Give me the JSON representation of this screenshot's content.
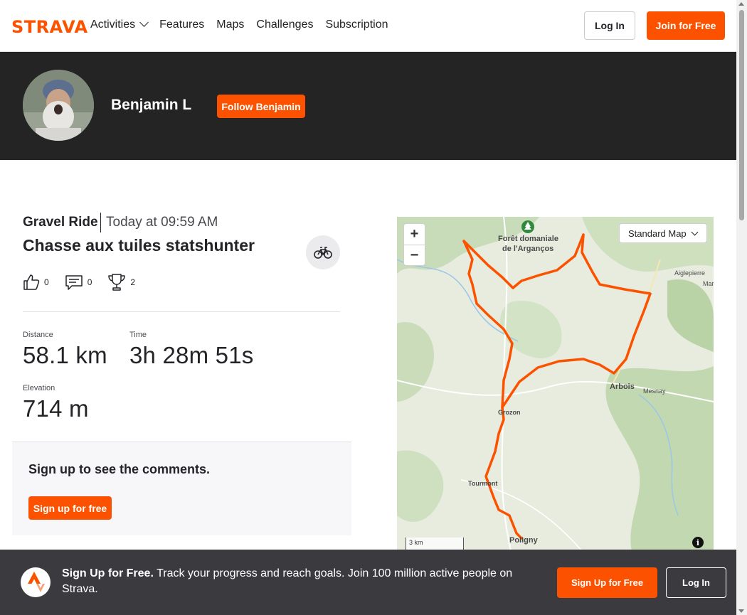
{
  "nav": {
    "logo": "STRAVA",
    "links": [
      "Activities",
      "Features",
      "Maps",
      "Challenges",
      "Subscription"
    ],
    "login_label": "Log In",
    "join_label": "Join for Free"
  },
  "athlete": {
    "name": "Benjamin L",
    "follow_label": "Follow Benjamin"
  },
  "activity": {
    "type": "Gravel Ride",
    "time": "Today at 09:59 AM",
    "title": "Chasse aux tuiles statshunter",
    "kudos": "0",
    "comments": "0",
    "achievements": "2",
    "stats": {
      "distance_label": "Distance",
      "distance_value": "58.1 km",
      "time_label": "Time",
      "time_value": "3h 28m 51s",
      "elevation_label": "Elevation",
      "elevation_value": "714 m"
    }
  },
  "comments": {
    "prompt": "Sign up to see the comments.",
    "signup_label": "Sign up for free"
  },
  "map": {
    "zoom_in": "+",
    "zoom_out": "−",
    "map_type": "Standard Map",
    "labels": {
      "forest": "Forêt domaniale",
      "forest2": "de l'Arganços",
      "aiglepierre": "Aiglepierre",
      "mar": "Mar",
      "arbois": "Arbois",
      "mesnay": "Mesnay",
      "grozon": "Grozon",
      "tourmont": "Tourmont",
      "poligny": "Poligny"
    },
    "scale": "3 km",
    "route_color": "#fc5200"
  },
  "banner": {
    "headline": "Sign Up for Free.",
    "text": " Track your progress and reach goals. Join 100 million active people on Strava.",
    "signup_label": "Sign Up for Free",
    "login_label": "Log In"
  }
}
